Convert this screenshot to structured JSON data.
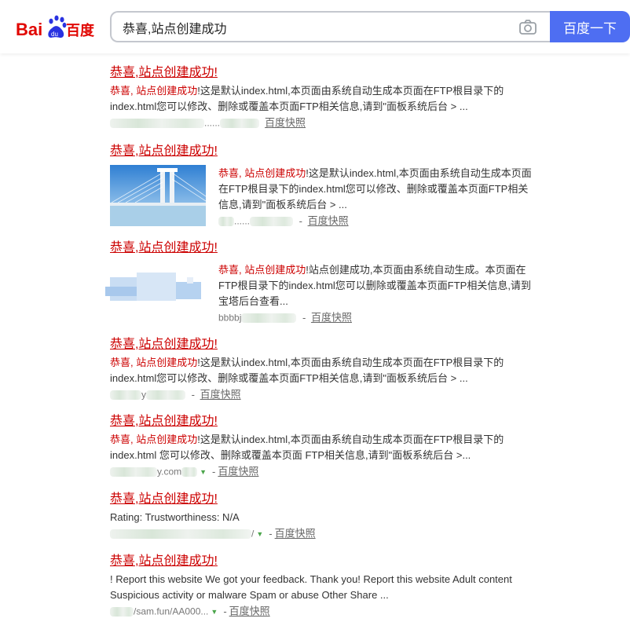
{
  "header": {
    "logo_text": "Bai百度",
    "search": {
      "value": "恭喜,站点创建成功",
      "camera_icon": "camera-icon"
    },
    "search_button_label": "百度一下",
    "brand_color": "#4e6ef2"
  },
  "results": [
    {
      "title": "恭喜,站点创建成功!",
      "abstract_highlight": "恭喜, 站点创建成功",
      "abstract_text": "!这是默认index.html,本页面由系统自动生成本页面在FTP根目录下的index.html您可以修改、删除或覆盖本页面FTP相关信息,请到\"面板系统后台 > ...",
      "url": "......",
      "snapshot": "百度快照"
    },
    {
      "title": "恭喜,站点创建成功!",
      "abstract_highlight": "恭喜, 站点创建成功",
      "abstract_text": "!这是默认index.html,本页面由系统自动生成本页面在FTP根目录下的index.html您可以修改、删除或覆盖本页面FTP相关信息,请到\"面板系统后台 > ...",
      "url": "......",
      "snapshot": "百度快照"
    },
    {
      "title": "恭喜,站点创建成功!",
      "abstract_highlight": "恭喜, 站点创建成功",
      "abstract_text": "!站点创建成功,本页面由系统自动生成。本页面在FTP根目录下的index.html您可以删除或覆盖本页面FTP相关信息,请到宝塔后台查看...",
      "url": "bbbbj",
      "snapshot": "百度快照"
    },
    {
      "title": "恭喜,站点创建成功!",
      "abstract_highlight": "恭喜, 站点创建成功",
      "abstract_text": "!这是默认index.html,本页面由系统自动生成本页面在FTP根目录下的index.html您可以修改、删除或覆盖本页面FTP相关信息,请到\"面板系统后台 > ...",
      "url": "y",
      "snapshot": "百度快照"
    },
    {
      "title": "恭喜,站点创建成功!",
      "abstract_highlight": "恭喜, 站点创建成功",
      "abstract_text": "!这是默认index.html,本页面由系统自动生成本页面在FTP根目录下的index.html 您可以修改、删除或覆盖本页面 FTP相关信息,请到\"面板系统后台 >...",
      "url": "y.com",
      "snapshot": "百度快照"
    },
    {
      "title": "恭喜,站点创建成功!",
      "abstract_text": "Rating: Trustworthiness: N/A",
      "url": "/",
      "snapshot": "百度快照"
    },
    {
      "title": "恭喜,站点创建成功!",
      "abstract_text": "! Report this website We got your feedback. Thank you! Report this website Adult content Suspicious activity or malware Spam or abuse Other Share ...",
      "url": "/sam.fun/AA000...",
      "snapshot": "百度快照"
    }
  ]
}
